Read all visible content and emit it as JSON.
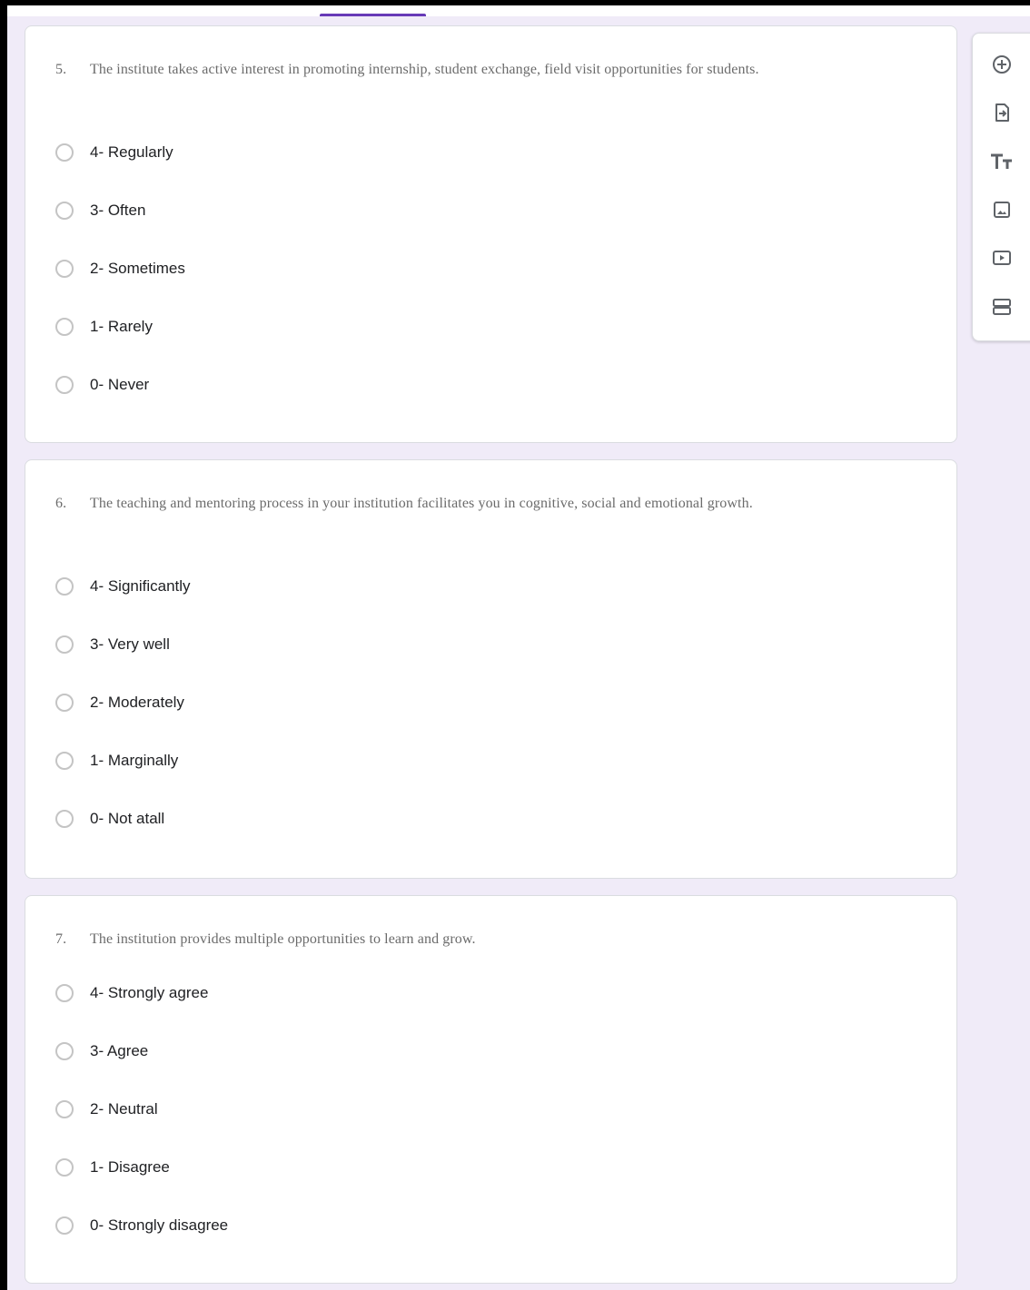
{
  "questions": [
    {
      "number": "5.",
      "text": "The institute takes active interest in promoting internship, student exchange, field visit opportunities for students.",
      "options": [
        "4- Regularly",
        "3- Often",
        "2- Sometimes",
        "1- Rarely",
        "0- Never"
      ]
    },
    {
      "number": "6.",
      "text": "The teaching and mentoring process in your institution facilitates you in cognitive, social and emotional growth.",
      "options": [
        "4- Significantly",
        "3- Very well",
        "2- Moderately",
        "1- Marginally",
        "0- Not atall"
      ]
    },
    {
      "number": "7.",
      "text": "The institution provides multiple opportunities to learn and grow.",
      "options": [
        "4- Strongly agree",
        "3- Agree",
        "2- Neutral",
        "1- Disagree",
        "0- Strongly disagree"
      ]
    }
  ],
  "toolbar": {
    "icons": [
      "add-question-icon",
      "import-questions-icon",
      "add-title-icon",
      "add-image-icon",
      "add-video-icon",
      "add-section-icon"
    ]
  },
  "colors": {
    "accent": "#673ab7",
    "background": "#f0ebf8",
    "card": "#ffffff"
  }
}
